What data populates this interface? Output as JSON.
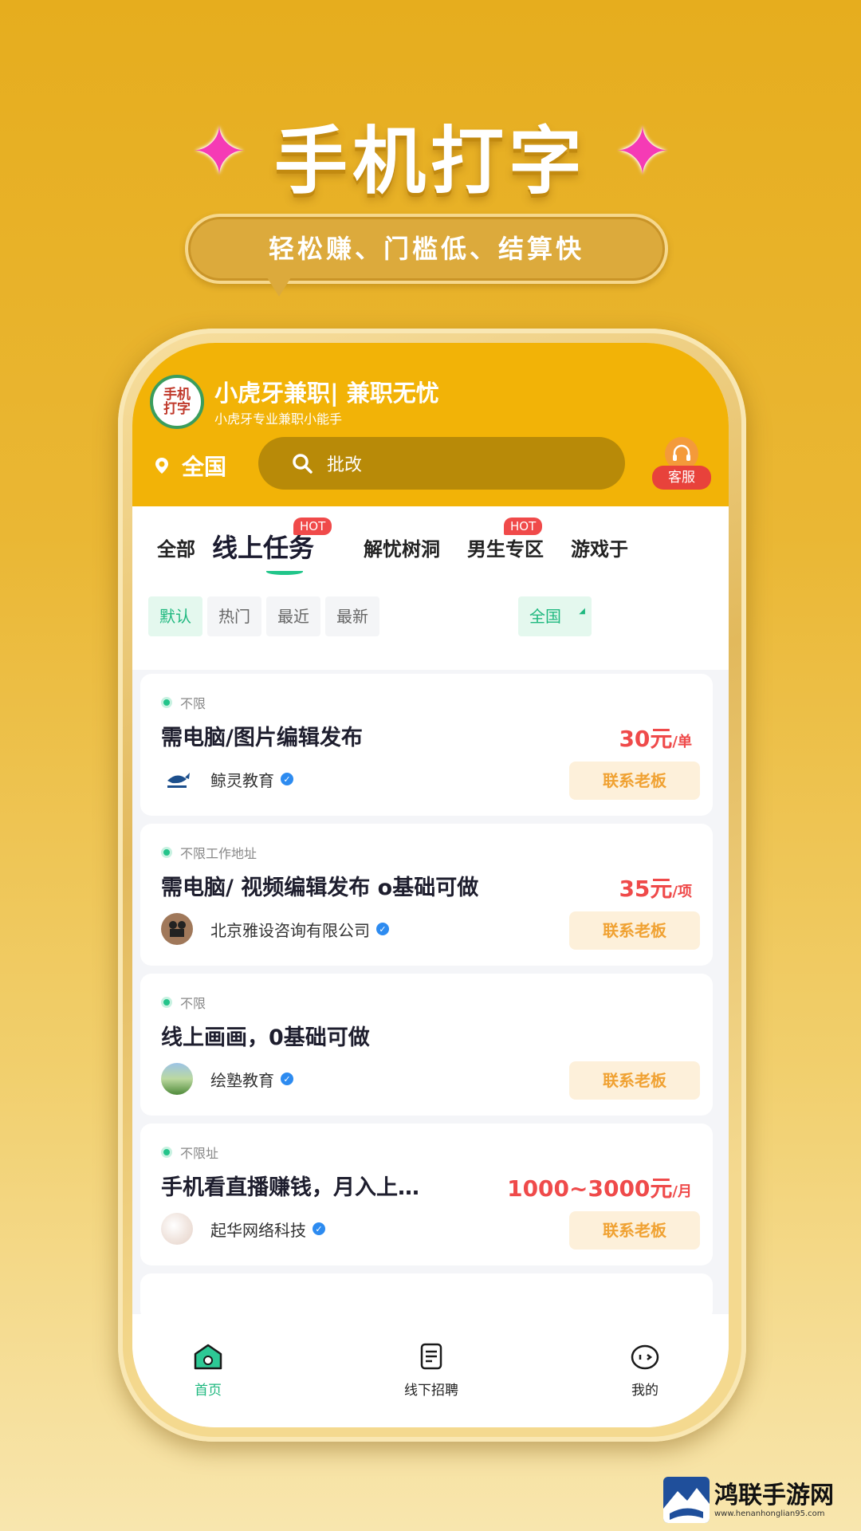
{
  "promo": {
    "title": "手机打字",
    "tagline": "轻松赚、门槛低、结算快"
  },
  "app": {
    "logo_text": [
      "手机",
      "打字"
    ],
    "name": "小虎牙兼职| 兼职无忧",
    "subtitle": "小虎牙专业兼职小能手",
    "location": "全国",
    "search_placeholder": "批改",
    "service_label": "客服",
    "accent_color": "#f2b307",
    "green_color": "#1fb87f",
    "price_color": "#ef4a4a"
  },
  "tabs": [
    {
      "label": "全部"
    },
    {
      "label": "线上任务",
      "badge": "HOT",
      "active": true
    },
    {
      "label": "解忧树洞"
    },
    {
      "label": "男生专区",
      "badge": "HOT"
    },
    {
      "label": "游戏于"
    }
  ],
  "filters": [
    "默认",
    "热门",
    "最近",
    "最新"
  ],
  "region_filter": "全国",
  "jobs": [
    {
      "location": "不限",
      "title": "需电脑/图片编辑发布",
      "price": "30元",
      "unit": "/单",
      "company": "鲸灵教育",
      "action": "联系老板"
    },
    {
      "location": "不限工作地址",
      "title": "需电脑/ 视频编辑发布 o基础可做",
      "price": "35元",
      "unit": "/项",
      "company": "北京雅设咨询有限公司",
      "action": "联系老板"
    },
    {
      "location": "不限",
      "title": "线上画画，0基础可做",
      "price": "",
      "unit": "",
      "company": "绘塾教育",
      "action": "联系老板"
    },
    {
      "location": "不限址",
      "title": "手机看直播赚钱，月入上…",
      "price": "1000~3000元",
      "unit": "/月",
      "company": "起华网络科技",
      "action": "联系老板"
    }
  ],
  "nav": [
    {
      "label": "首页",
      "icon": "home-icon",
      "active": true
    },
    {
      "label": "线下招聘",
      "icon": "document-icon"
    },
    {
      "label": "我的",
      "icon": "face-icon"
    }
  ],
  "watermark": {
    "title": "鸿联手游网",
    "url": "www.henanhonglian95.com"
  }
}
